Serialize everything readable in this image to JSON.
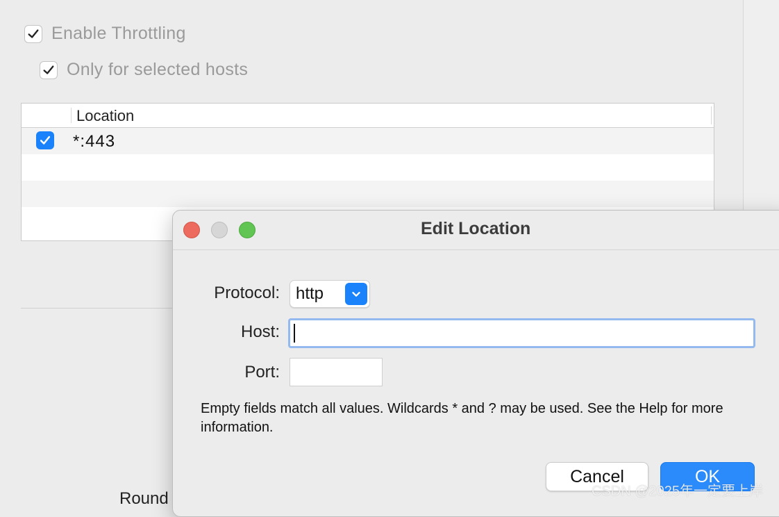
{
  "background": {
    "enable_throttling": {
      "label": "Enable Throttling",
      "checked": true
    },
    "only_selected_hosts": {
      "label": "Only for selected hosts",
      "checked": true
    },
    "locations_table": {
      "header": "Location",
      "rows": [
        {
          "enabled": true,
          "location": "*:443"
        }
      ]
    },
    "partial_label": "Round"
  },
  "dialog": {
    "title": "Edit Location",
    "protocol": {
      "label": "Protocol:",
      "value": "http"
    },
    "host": {
      "label": "Host:",
      "value": ""
    },
    "port": {
      "label": "Port:",
      "value": ""
    },
    "help_text": "Empty fields match all values. Wildcards * and ? may be used. See the Help for more information.",
    "buttons": {
      "cancel": "Cancel",
      "ok": "OK"
    }
  },
  "watermark": "CSDN @2025年一定要上岸",
  "colors": {
    "accent": "#1a82fb",
    "close": "#ed6a5e",
    "zoom": "#61c554"
  }
}
